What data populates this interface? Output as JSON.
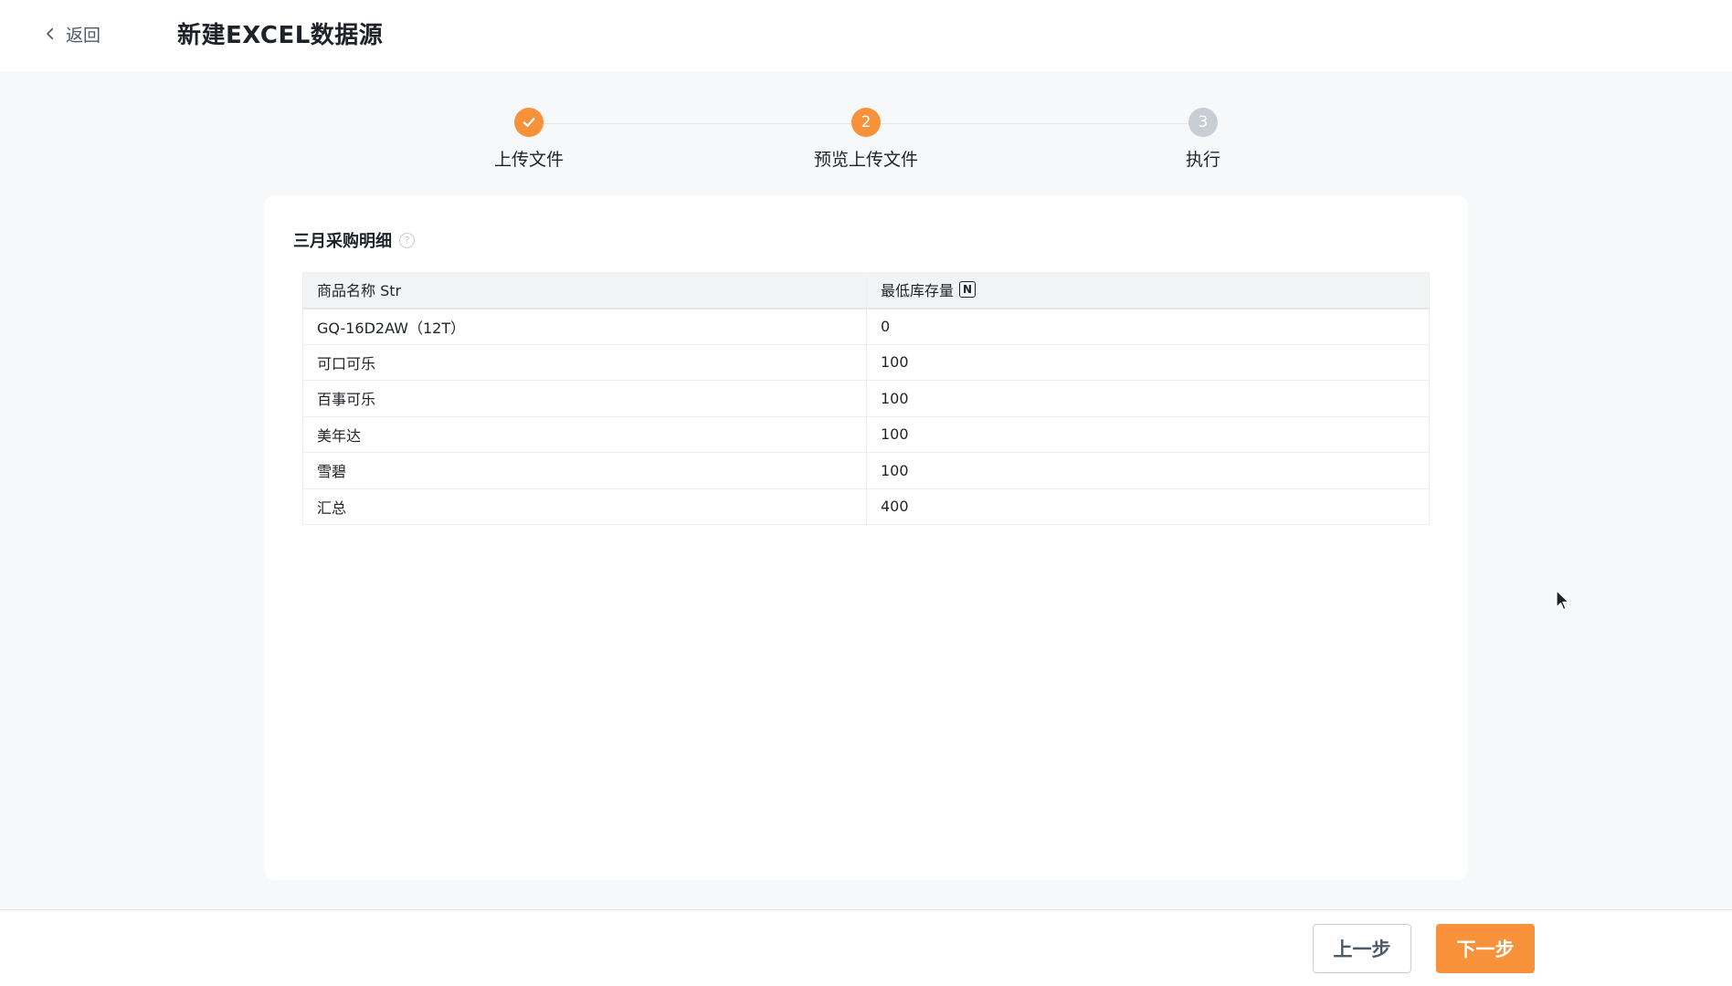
{
  "header": {
    "back_label": "返回",
    "title": "新建EXCEL数据源"
  },
  "steps": [
    {
      "number": "1",
      "label": "上传文件",
      "status": "done"
    },
    {
      "number": "2",
      "label": "预览上传文件",
      "status": "active"
    },
    {
      "number": "3",
      "label": "执行",
      "status": "pending"
    }
  ],
  "card": {
    "title": "三月采购明细",
    "help_icon": "question-circle-icon"
  },
  "table": {
    "columns": [
      {
        "name": "商品名称 Str",
        "type_badge": ""
      },
      {
        "name": "最低库存量",
        "type_badge": "N"
      }
    ],
    "rows": [
      [
        "GQ-16D2AW（12T）",
        "0"
      ],
      [
        "可口可乐",
        "100"
      ],
      [
        "百事可乐",
        "100"
      ],
      [
        "美年达",
        "100"
      ],
      [
        "雪碧",
        "100"
      ],
      [
        "汇总",
        "400"
      ]
    ]
  },
  "footer": {
    "prev_label": "上一步",
    "next_label": "下一步"
  },
  "colors": {
    "accent": "#f7923a",
    "pending": "#c9cdd4"
  }
}
